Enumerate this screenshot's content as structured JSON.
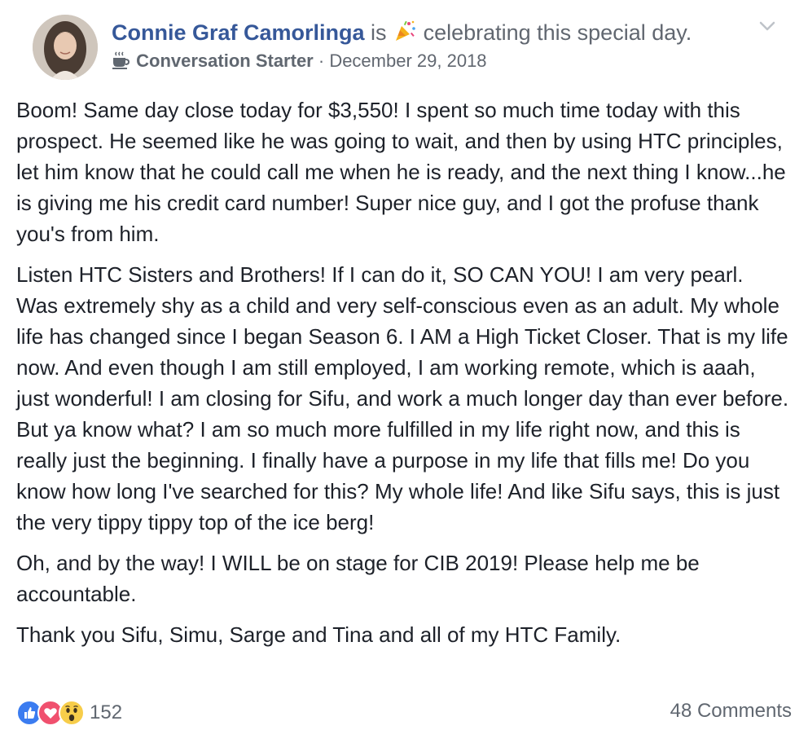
{
  "post": {
    "author": "Connie Graf Camorlinga",
    "activity_prefix": " is ",
    "activity_text": " celebrating this special day.",
    "badge_label": "Conversation Starter",
    "separator": " · ",
    "date": "December 29, 2018",
    "paragraphs": [
      "Boom! Same day close today for $3,550! I spent so much time today with this prospect. He seemed like he was going to wait, and then by using HTC principles, let him know that he could call me when he is ready, and the next thing I know...he is giving me his credit card number! Super nice guy, and I got the profuse thank you's from him.",
      "Listen HTC Sisters and Brothers! If I can do it, SO CAN YOU! I am very pearl. Was extremely shy as a child and very self-conscious even as an adult. My whole life has changed since I began Season 6. I AM a High Ticket Closer. That is my life now. And even though I am still employed, I am working remote, which is aaah, just wonderful! I am closing for Sifu, and work a much longer day than ever before. But ya know what? I am so much more fulfilled in my life right now, and this is really just the beginning. I finally have a purpose in my life that fills me! Do you know how long I've searched for this? My whole life! And like Sifu says, this is just the very tippy tippy top of the ice berg!",
      "Oh, and by the way! I WILL be on stage for CIB 2019! Please help me be accountable.",
      "Thank you Sifu, Simu, Sarge and Tina and all of my HTC Family."
    ]
  },
  "footer": {
    "reaction_count": "152",
    "comments_label": "48 Comments",
    "reaction_icons": [
      "like-icon",
      "love-icon",
      "wow-icon"
    ]
  },
  "icons": {
    "activity": "party-popper-icon",
    "badge": "coffee-cup-icon",
    "menu": "chevron-down-icon"
  },
  "colors": {
    "link_blue": "#365899",
    "meta_gray": "#616770",
    "text": "#1d2129",
    "like_blue": "#3b7cf0",
    "love_red": "#f0506e",
    "wow_yellow": "#f7cd4a"
  }
}
